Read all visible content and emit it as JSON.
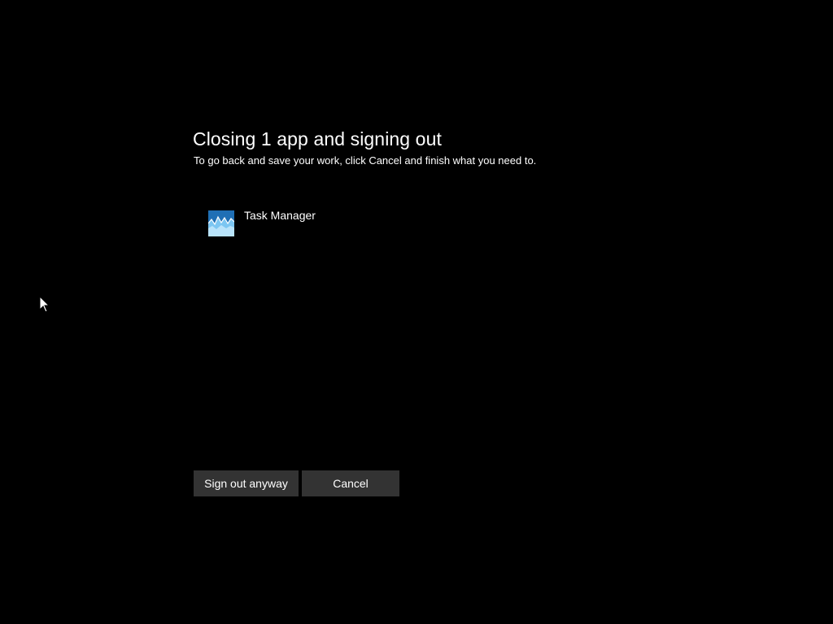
{
  "dialog": {
    "title": "Closing 1 app and signing out",
    "subtitle": "To go back and save your work, click Cancel and finish what you need to."
  },
  "apps": [
    {
      "name": "Task Manager",
      "icon": "task-manager-icon"
    }
  ],
  "buttons": {
    "sign_out_label": "Sign out anyway",
    "cancel_label": "Cancel"
  },
  "colors": {
    "background": "#000000",
    "text": "#ffffff",
    "button_bg": "#333333",
    "icon_blue": "#3aa0e6"
  }
}
